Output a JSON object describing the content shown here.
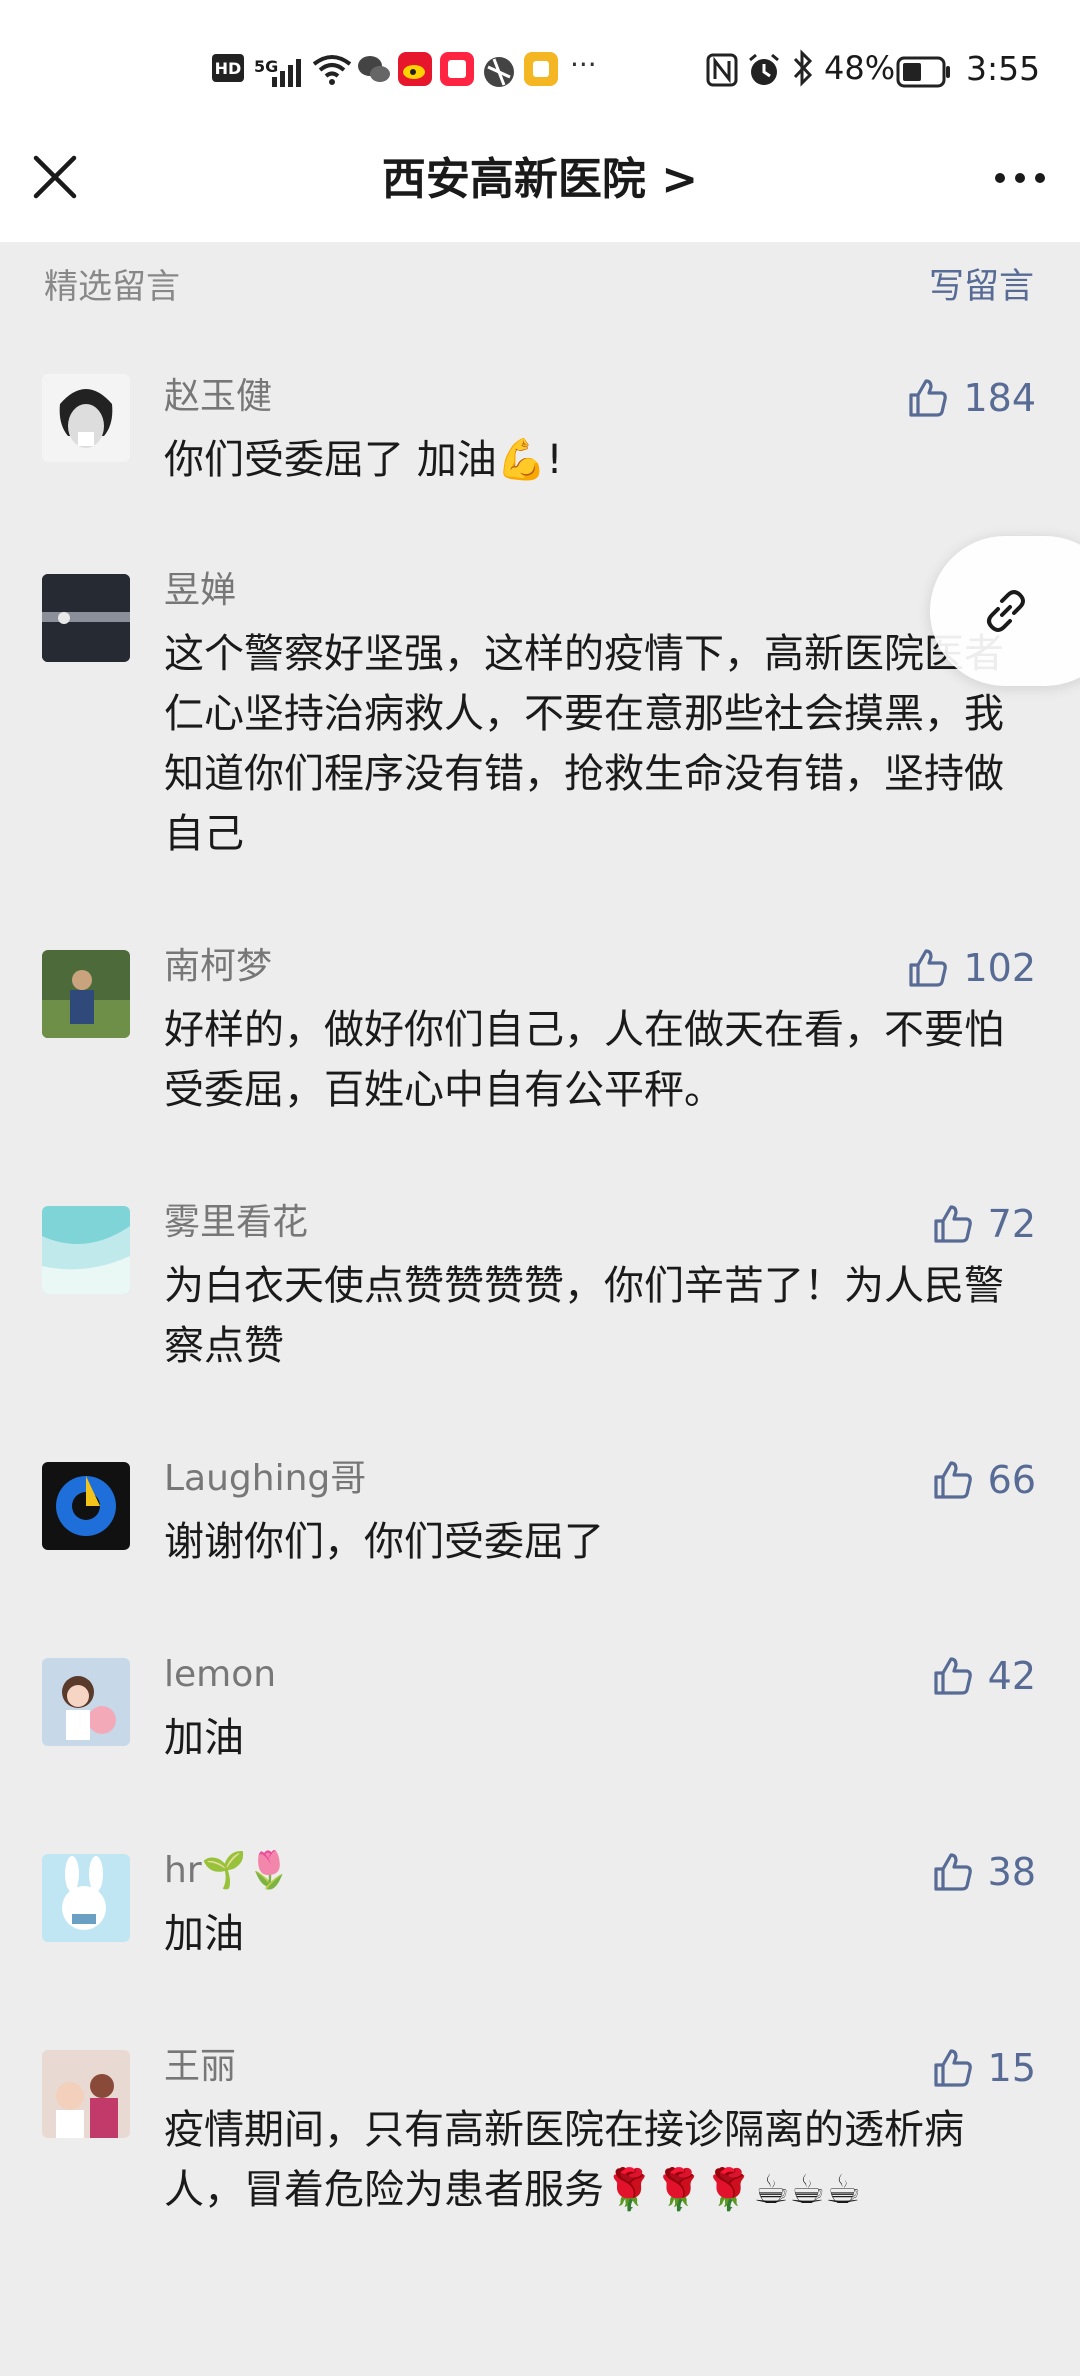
{
  "status_bar": {
    "hd": "HD",
    "network": "5G",
    "battery": "48%",
    "time": "3:55",
    "more_indicator": "···"
  },
  "header": {
    "title": "西安高新医院 >"
  },
  "section": {
    "title": "精选留言",
    "write_label": "写留言"
  },
  "comments": [
    {
      "nickname": "赵玉健",
      "text": "你们受委屈了 加油💪!",
      "likes": "184"
    },
    {
      "nickname": "昱婵",
      "text": "这个警察好坚强，这样的疫情下，高新医院医者仁心坚持治病救人，不要在意那些社会摸黑，我知道你们程序没有错，抢救生命没有错，坚持做自己",
      "likes": ""
    },
    {
      "nickname": "南柯梦",
      "text": "好样的，做好你们自己，人在做天在看，不要怕受委屈，百姓心中自有公平秤。",
      "likes": "102"
    },
    {
      "nickname": "雾里看花",
      "text": "为白衣天使点赞赞赞赞，你们辛苦了！为人民警察点赞",
      "likes": "72"
    },
    {
      "nickname": "Laughing哥",
      "text": "谢谢你们，你们受委屈了",
      "likes": "66"
    },
    {
      "nickname": "lemon",
      "text": "加油",
      "likes": "42"
    },
    {
      "nickname": "hr🌱🌷",
      "text": "加油",
      "likes": "38"
    },
    {
      "nickname": "王丽",
      "text": "疫情期间，只有高新医院在接诊隔离的透析病人，冒着危险为患者服务🌹🌹🌹☕☕☕",
      "likes": "15"
    }
  ],
  "colors": {
    "link_blue": "#576b95",
    "background": "#ededed"
  }
}
